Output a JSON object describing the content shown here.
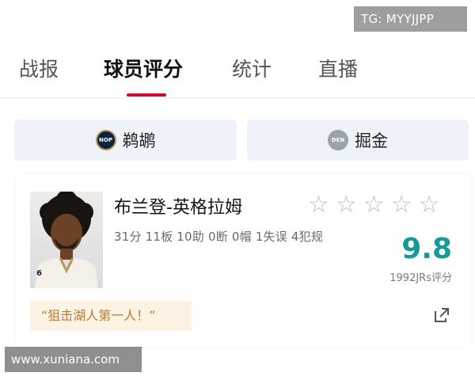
{
  "watermarks": {
    "top": "TG: MYYJJPP",
    "bottom": "www.xuniana.com"
  },
  "tabs": [
    {
      "label": "战报",
      "active": false
    },
    {
      "label": "球员评分",
      "active": true
    },
    {
      "label": "统计",
      "active": false
    },
    {
      "label": "直播",
      "active": false
    }
  ],
  "teams": [
    {
      "name": "鹈鹕",
      "logo_text": "NOP",
      "logo_color": "#0c2340",
      "selected": true
    },
    {
      "name": "掘金",
      "logo_text": "DEN",
      "logo_color": "#9aa3ad",
      "selected": false
    }
  ],
  "player": {
    "name": "布兰登-英格拉姆",
    "stats": "31分 11板 10助 0断 0帽 1失误 4犯规",
    "rating": "9.8",
    "rating_count": "1992JRs评分",
    "star_rating": 0,
    "star_max": 5,
    "quote": "“狙击湖人第一人！”",
    "jersey_number": "6"
  },
  "colors": {
    "accent": "#c8102e",
    "rating": "#159a9a",
    "quote_text": "#c07a2a",
    "quote_bg": "#fdf3e5"
  }
}
